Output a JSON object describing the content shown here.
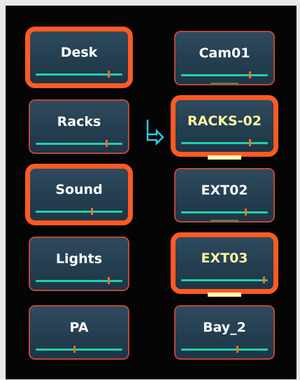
{
  "sources": [
    {
      "label": "Desk",
      "selected": true,
      "level": 0.85
    },
    {
      "label": "Racks",
      "selected": false,
      "level": 0.83
    },
    {
      "label": "Sound",
      "selected": true,
      "level": 0.65
    },
    {
      "label": "Lights",
      "selected": false,
      "level": 0.85
    },
    {
      "label": "PA",
      "selected": false,
      "level": 0.45
    }
  ],
  "destinations": [
    {
      "label": "Cam01",
      "selected": false,
      "highlight": false,
      "level": 0.8,
      "tally": "dim"
    },
    {
      "label": "RACKS-02",
      "selected": true,
      "highlight": true,
      "level": 0.8,
      "tally": "on"
    },
    {
      "label": "EXT02",
      "selected": false,
      "highlight": false,
      "level": 0.75,
      "tally": "dim"
    },
    {
      "label": "EXT03",
      "selected": true,
      "highlight": true,
      "level": 0.97,
      "tally": "on"
    },
    {
      "label": "Bay_2",
      "selected": false,
      "highlight": false,
      "level": 0.65,
      "tally": "none"
    }
  ],
  "route_icon": "route-arrow-icon",
  "colors": {
    "selected_border": "#ff5a23",
    "normal_border": "#b84a33",
    "meter": "#1fd3a4",
    "meter_marker": "#ff6a2a",
    "highlight_text": "#fff5a0",
    "route_arrow": "#2ec8e6"
  }
}
